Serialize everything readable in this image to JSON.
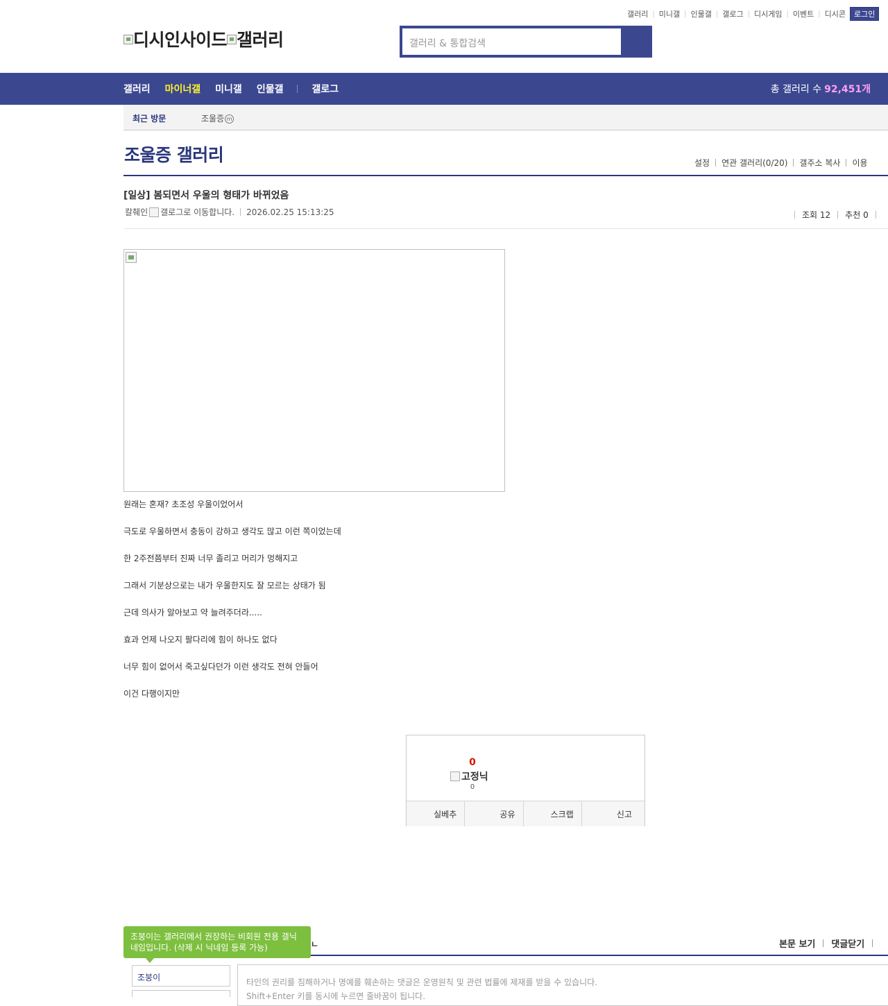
{
  "util_links": [
    "갤러리",
    "미니갤",
    "인물갤",
    "갤로그",
    "디시게임",
    "이벤트",
    "디시콘"
  ],
  "login_label": "로그인",
  "logo": {
    "part1": "디시인사이드",
    "part2": "갤러리"
  },
  "search": {
    "placeholder": "갤러리 & 통합검색"
  },
  "gnb": {
    "items": [
      "갤러리",
      "마이너갤",
      "미니갤",
      "인물갤"
    ],
    "active": "마이너갤",
    "gallog": "갤로그",
    "count_label": "총 갤러리 수",
    "count_value": "92,451개"
  },
  "recent": {
    "label": "최근 방문",
    "gallery": "조울증",
    "badge": "ⓜ"
  },
  "gallery": {
    "title": "조울증 갤러리",
    "options": [
      "설정",
      "연관 갤러리(0/20)",
      "갤주소 복사",
      "이용"
    ]
  },
  "post": {
    "title": "[일상] 봄되면서 우울의 형태가 바뀌었음",
    "author": "칼췌인",
    "author_suffix": "갤로그로 이동합니다.",
    "datetime": "2026.02.25 15:13:25",
    "views": "조회 12",
    "recommend": "추천 0",
    "lines": [
      "원래는 혼재? 초조성 우울이었어서",
      "극도로 우울하면서 충동이 강하고 생각도 많고 이런 쪽이었는데",
      "한 2주전쯤부터 진짜 너무 졸리고 머리가 멍해지고",
      "그래서 기분상으로는 내가 우울한지도 잘 모르는 상태가 됨",
      "근데 의사가 알아보고 약 늘려주더라.....",
      "효과 언제 나오지 팔다리에 힘이 하나도 없다",
      "너무 힘이 없어서 죽고싶다던가 이런 생각도 전혀 안들어",
      "이건 다행이지만"
    ]
  },
  "recommend_box": {
    "count": "0",
    "nick_label": "고정닉",
    "nick_count": "0",
    "buttons": [
      "실베추",
      "공유",
      "스크랩",
      "신고"
    ]
  },
  "comments": {
    "tip": "조붕이는 갤러리에서 권장하는 비회원 전용 갤닉네임입니다. (삭제 시 닉네임 등록 가능)",
    "tip_tail": "ㄴ",
    "links": [
      "본문 보기",
      "댓글닫기"
    ],
    "nick_value": "조붕이",
    "textarea_placeholder": "타인의 권리를 침해하거나 명예를 훼손하는 댓글은 운영원칙 및 관련 법률에 제재를 받을 수 있습니다.",
    "textarea_placeholder2": "Shift+Enter 키를 동시에 누르면 줄바꿈이 됩니다."
  }
}
